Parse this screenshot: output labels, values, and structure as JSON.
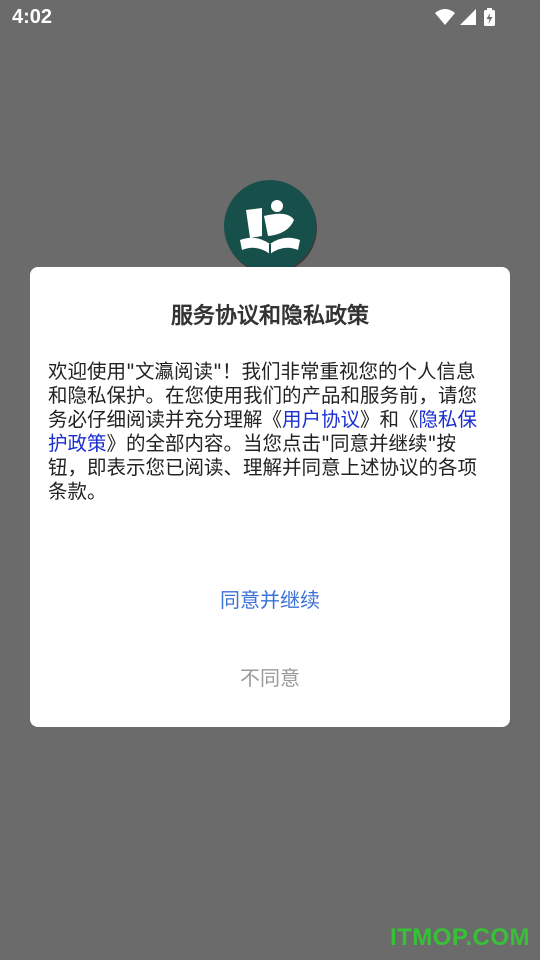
{
  "status_bar": {
    "time": "4:02",
    "icons": [
      "wifi-icon",
      "cell-signal-icon",
      "battery-charging-icon"
    ]
  },
  "app": {
    "logo_icon": "book-reader-logo"
  },
  "dialog": {
    "title": "服务协议和隐私政策",
    "body": {
      "part1": "欢迎使用\"文瀛阅读\"！我们非常重视您的个人信息和隐私保护。在您使用我们的产品和服务前，请您务必仔细阅读并充分理解《",
      "link_user_agreement": "用户协议",
      "part2": "》和《",
      "link_privacy_policy": "隐私保护政策",
      "part3": "》的全部内容。当您点击\"同意并继续\"按钮，即表示您已阅读、理解并同意上述协议的各项条款。"
    },
    "agree_label": "同意并继续",
    "disagree_label": "不同意"
  },
  "colors": {
    "overlay": "#6b6b6b",
    "link": "#1a2fd0",
    "primary_button": "#3b72d6",
    "secondary_button": "#9a9a9a",
    "logo_bg": "#17504a",
    "watermark": "#2fd12f"
  },
  "watermark": "ITMOP.COM"
}
